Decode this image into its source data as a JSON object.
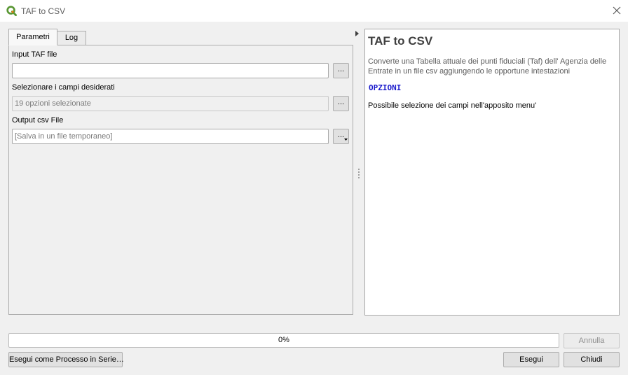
{
  "window": {
    "title": "TAF to CSV",
    "icon": "qgis-logo-icon",
    "close_icon": "close-icon"
  },
  "tabs": [
    {
      "label": "Parametri",
      "active": true
    },
    {
      "label": "Log",
      "active": false
    }
  ],
  "form": {
    "input_taf": {
      "label": "Input TAF file",
      "value": "",
      "browse_label": "..."
    },
    "fields": {
      "label": "Selezionare i campi desiderati",
      "value": "19 opzioni selezionate",
      "browse_label": "..."
    },
    "output_csv": {
      "label": "Output csv File",
      "value": "[Salva in un file temporaneo]",
      "browse_label": "..."
    }
  },
  "help": {
    "title": "TAF to CSV",
    "description": "Converte una Tabella attuale dei punti fiduciali (Taf) dell' Agenzia delle Entrate in un file csv aggiungendo le opportune intestazioni",
    "options_heading": "OPZIONI",
    "note": "Possibile selezione dei campi nell'apposito menu'"
  },
  "progress": {
    "value_percent": 0,
    "label": "0%"
  },
  "buttons": {
    "cancel": "Annulla",
    "batch": "Esegui come Processo in Serie…",
    "run": "Esegui",
    "close": "Chiudi"
  },
  "colors": {
    "options_heading": "#1a1acc",
    "progress_fill": "#06b025",
    "qgis_green": "#589632",
    "qgis_yellow": "#ee7913"
  }
}
